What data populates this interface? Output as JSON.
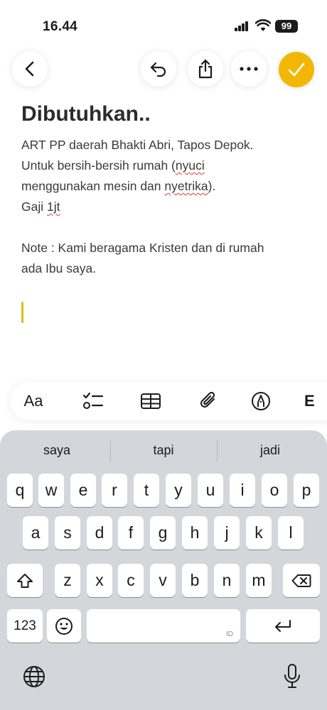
{
  "status": {
    "time": "16.44",
    "battery": "99"
  },
  "icons": {
    "back": "chevron-left-icon",
    "undo": "undo-icon",
    "share": "share-icon",
    "more": "ellipsis-icon",
    "done": "checkmark-icon",
    "checklist": "checklist-icon",
    "table": "table-icon",
    "attach": "paperclip-icon",
    "markup": "pen-circle-icon",
    "shift": "shift-icon",
    "delete": "delete-icon",
    "emoji": "emoji-icon",
    "return": "return-icon",
    "globe": "globe-icon",
    "mic": "microphone-icon"
  },
  "colors": {
    "accent": "#f2b705",
    "caret": "#e8b80c",
    "keyboard_bg": "#d4d6dc",
    "spellcheck": "#e0363a"
  },
  "note": {
    "title": "Dibutuhkan..",
    "line1": "ART PP daerah Bhakti Abri, Tapos Depok.",
    "line2_pre": "Untuk bersih-bersih rumah (",
    "line2_word": "nyuci",
    "line3_pre": "menggunakan mesin dan ",
    "line3_word": "nyetrika",
    "line3_post": ").",
    "line4_pre": "Gaji ",
    "line4_word": "1jt",
    "line5": "Note : Kami beragama Kristen dan di rumah",
    "line6": "ada Ibu saya."
  },
  "format_bar": {
    "text_style": "Aa",
    "partial_item": "E"
  },
  "keyboard": {
    "suggestions": [
      "saya",
      "tapi",
      "jadi"
    ],
    "row1": [
      "q",
      "w",
      "e",
      "r",
      "t",
      "y",
      "u",
      "i",
      "o",
      "p"
    ],
    "row2": [
      "a",
      "s",
      "d",
      "f",
      "g",
      "h",
      "j",
      "k",
      "l"
    ],
    "row3": [
      "z",
      "x",
      "c",
      "v",
      "b",
      "n",
      "m"
    ],
    "numbers_key": "123",
    "space_hint": "ID"
  }
}
